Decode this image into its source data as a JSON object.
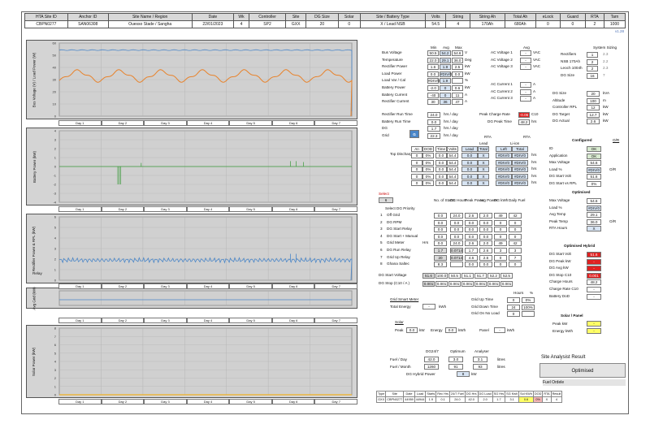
{
  "header": {
    "labels": [
      "HTA Site ID",
      "Anchor ID",
      "Site Name / Region",
      "Date",
      "Wk",
      "Controller",
      "Site",
      "DG Size",
      "Solar",
      "Site / Battery Type",
      "Volts",
      "String",
      "String Ah",
      "Total Ah",
      "eLock",
      "Guard",
      "RTA",
      "Tarn"
    ],
    "values": [
      "CBPN0277",
      "SAN06308",
      "Ouesso Stade / Sangha",
      "22/01/2023",
      "4",
      "SP2",
      "GXX",
      "20",
      "0",
      "X / Lead NSB",
      "54.5",
      "4",
      "170Ah",
      "680Ah",
      "0",
      "0",
      "2",
      "1000"
    ]
  },
  "version": "v1.28",
  "days": [
    "Day 1",
    "Day 2",
    "Day 3",
    "Day 4",
    "Day 5",
    "Day 6",
    "Day 7"
  ],
  "charts": {
    "bus_voltage": {
      "ylabel": "Bus Voltage (V) / Load Power (W)",
      "yticks": [
        "60",
        "50",
        "40",
        "30",
        "20",
        "10",
        "0"
      ],
      "colors": {
        "voltage": "#4a86c8",
        "load": "#e8822a"
      }
    },
    "battery_power": {
      "ylabel": "Battery Power (kW)",
      "yticks": [
        "4",
        "3",
        "2",
        "1",
        "0",
        "-1",
        "-2",
        "-3",
        "-4"
      ],
      "color": "#3a9a3a"
    },
    "rectifier_power": {
      "ylabel": "Rectifier Power & RPL (kW)",
      "yticks": [
        "6",
        "5",
        "4",
        "3",
        "2",
        "1",
        "0"
      ],
      "color": "#4a86c8",
      "side_label": "Relay"
    },
    "relay": {
      "ylabel": "Avg Grid (kW)"
    },
    "solar_power": {
      "ylabel": "Solar Power (kW)",
      "yticks": [
        "8",
        "7",
        "6",
        "5",
        "4",
        "3",
        "2",
        "1",
        "0"
      ],
      "color": "#f0b020"
    }
  },
  "stats": {
    "cols": [
      "Min",
      "Avg",
      "Max"
    ],
    "rows": [
      {
        "label": "Bus Voltage",
        "vals": [
          "50.5",
          "54.2",
          "54.6"
        ],
        "unit": "V"
      },
      {
        "label": "Temperature",
        "vals": [
          "22.0",
          "29.1",
          "36.0"
        ],
        "unit": "Deg"
      },
      {
        "label": "Rectifier Power",
        "vals": [
          "1.6",
          "1.9",
          "2.5"
        ],
        "unit": "kW"
      },
      {
        "label": "Load Power",
        "vals": [
          "0.0",
          "#DIV/0",
          "0.0"
        ],
        "unit": "kW"
      },
      {
        "label": "Load Var / Cal",
        "vals": [
          "#DIV/0",
          "1.9",
          ""
        ],
        "unit": "%"
      },
      {
        "label": "Battery Power",
        "vals": [
          "-2.0",
          "0",
          "0.6"
        ],
        "unit": "kW"
      },
      {
        "label": "Battery Current",
        "vals": [
          "-40",
          "0",
          "11"
        ],
        "unit": "A"
      },
      {
        "label": "Rectifier Current",
        "vals": [
          "30",
          "36",
          "47"
        ],
        "unit": "A"
      }
    ],
    "ac_avg_label": "Avg",
    "ac": [
      {
        "label": "AC Voltage 1",
        "val": "-",
        "unit": "VAC"
      },
      {
        "label": "AC Voltage 2",
        "val": "-",
        "unit": "VAC"
      },
      {
        "label": "AC Voltage 3",
        "val": "-",
        "unit": "VAC"
      },
      {
        "label": "AC Current 1",
        "val": "-",
        "unit": "A"
      },
      {
        "label": "AC Current 2",
        "val": "-",
        "unit": "A"
      },
      {
        "label": "AC Current 3",
        "val": "-",
        "unit": "A"
      }
    ],
    "run": [
      {
        "label": "Rectifier Run Time",
        "val": "24.0",
        "unit": "hrs / day"
      },
      {
        "label": "Battery Run Time",
        "val": "0.0",
        "unit": "hrs / day"
      },
      {
        "label": "DG",
        "val": "1.7",
        "unit": "hrs / day"
      },
      {
        "label": "Grid",
        "val": "22.3",
        "unit": "hrs / day"
      }
    ],
    "peak_charge": {
      "label": "Peak Charge Rate",
      "val": "-0.06",
      "unit": "C10"
    },
    "dg_peak": {
      "label": "DG Peak Time",
      "val": "48.2",
      "unit": "hrs"
    }
  },
  "sizing": {
    "title": "System Sizing",
    "rows": [
      {
        "label": "Rectifiers",
        "val": "1",
        "extra": "2.3"
      },
      {
        "label": "NSB 170Ah",
        "val": "2",
        "extra": "2.2"
      },
      {
        "label": "Leoch 1004h",
        "val": "2",
        "extra": "2.3"
      },
      {
        "label": "DG Size",
        "val": "16",
        "extra": "7"
      }
    ],
    "dg": [
      {
        "label": "DG Size",
        "val": "20",
        "unit": "kVA"
      },
      {
        "label": "Altitude",
        "val": "100",
        "unit": "m"
      },
      {
        "label": "Controller RPL",
        "val": "12",
        "unit": "kW"
      },
      {
        "label": "DG Target",
        "val": "12.7",
        "unit": "kW"
      },
      {
        "label": "DG Actual",
        "val": "2.6",
        "unit": "kW"
      }
    ]
  },
  "discharges": {
    "title": "Top Discharges",
    "group_lead": "Lead",
    "group_liion": "Li-ion",
    "rta": "RTA",
    "cols": [
      "An",
      "DOD",
      "Time",
      "Volts",
      "Lead Left",
      "Total",
      "Left",
      "Total"
    ],
    "rows": [
      [
        "0",
        "0%",
        "0.0",
        "54.4",
        "0.0",
        "X",
        "#DIV/0",
        "#DIV/0"
      ],
      [
        "0",
        "0%",
        "0.0",
        "54.4",
        "0.0",
        "X",
        "#DIV/0",
        "#DIV/0"
      ],
      [
        "0",
        "0%",
        "0.0",
        "54.4",
        "0.0",
        "X",
        "#DIV/0",
        "#DIV/0"
      ],
      [
        "0",
        "0%",
        "0.0",
        "54.4",
        "0.0",
        "X",
        "#DIV/0",
        "#DIV/0"
      ],
      [
        "0",
        "0%",
        "0.0",
        "54.4",
        "0.0",
        "X",
        "#DIV/0",
        "#DIV/0"
      ]
    ],
    "unit": "hrs"
  },
  "configured": {
    "title": "Configured",
    "tag": "O/R",
    "rows": [
      {
        "label": "ID",
        "val": "OK"
      },
      {
        "label": "Application",
        "val": "OK"
      },
      {
        "label": "Max Voltage",
        "val": "54.6"
      },
      {
        "label": "Load %",
        "val": "#DIV/0"
      },
      {
        "label": "DG Start Volt",
        "val": "51.6"
      },
      {
        "label": "DG Start vs RPL",
        "val": "0%"
      }
    ]
  },
  "dg_priority": {
    "select_label": "Select",
    "select_val": "6",
    "title": "Select DG Priority",
    "cols": [
      "No. of Starts",
      "DG Hours",
      "Peak Power",
      "Avg Power",
      "DG kWh",
      "Daily Fuel"
    ],
    "rows": [
      {
        "n": "1",
        "label": "Off Grid",
        "vals": [
          "0.0",
          "24.0",
          "2.6",
          "2.0",
          "49",
          "42"
        ]
      },
      {
        "n": "2",
        "label": "DG RPM",
        "vals": [
          "0.0",
          "0.0",
          "0.0",
          "0.0",
          "0",
          "0"
        ]
      },
      {
        "n": "3",
        "label": "DG Start Relay",
        "vals": [
          "0.0",
          "0.0",
          "0.0",
          "0.0",
          "0",
          "0"
        ]
      },
      {
        "n": "4",
        "label": "DG Start + Manual",
        "vals": [
          "0.0",
          "0.0",
          "0.0",
          "0.0",
          "0",
          "0"
        ]
      },
      {
        "n": "5",
        "label": "Grid Meter",
        "vals": [
          "0.0",
          "24.0",
          "2.6",
          "2.0",
          "49",
          "42"
        ],
        "hrs": "Hrs"
      },
      {
        "n": "6",
        "label": "DG Run Relay",
        "vals": [
          "1.7",
          "0.0714",
          "1.7",
          "2.6",
          "3",
          "3"
        ]
      },
      {
        "n": "7",
        "label": "Grid Up Relay",
        "vals": [
          "20",
          "0.0714",
          "4.6",
          "2.6",
          "0",
          "7"
        ]
      },
      {
        "n": "8",
        "label": "Ghana Saltec",
        "vals": [
          "8.3",
          "",
          "0.0",
          "0.0",
          "0",
          "0"
        ]
      }
    ],
    "start_voltage": {
      "label": "DG Start Voltage",
      "vals": [
        "51.6",
        "100.0",
        "50.5",
        "51.1",
        "51.7",
        "52.2",
        "52.5"
      ]
    },
    "stop": {
      "label": "DG Stop (C10 / A )",
      "vals": [
        "0.001",
        "0.001",
        "0.001",
        "0.001",
        "0.001",
        "0.001",
        "0.001"
      ]
    }
  },
  "optimised": {
    "title": "Optimised",
    "rows": [
      {
        "label": "Max Voltage",
        "val": "54.6"
      },
      {
        "label": "Load %",
        "val": "#DIV/0"
      },
      {
        "label": "Avg Temp",
        "val": "29.1"
      },
      {
        "label": "Peak Temp",
        "val": "36.0"
      },
      {
        "label": "RTA Hours",
        "val": "X"
      }
    ],
    "tag": "O/R"
  },
  "hybrid": {
    "title": "Optimised Hybrid",
    "rows": [
      {
        "label": "DG Start Volt",
        "val": "51.6"
      },
      {
        "label": "DG Peak kW",
        "val": "-"
      },
      {
        "label": "DG Avg kW",
        "val": "-"
      },
      {
        "label": "DG Stop C10",
        "val": "0.001"
      },
      {
        "label": "Charge Hours",
        "val": "48.2"
      },
      {
        "label": "Charge Rate C10",
        "val": "-"
      },
      {
        "label": "Battery DoD",
        "val": "-"
      }
    ],
    "hours_label": "Hours",
    "pct_label": "%"
  },
  "grid_meter": {
    "title": "Grid Smart Meter",
    "total_energy": {
      "label": "Total Energy",
      "val": "-",
      "unit": "kWh"
    },
    "rows": [
      {
        "label": "Grid Up Time",
        "hours": "0",
        "pct": "0%"
      },
      {
        "label": "Grid Down Time",
        "hours": "24",
        "pct": "100%"
      },
      {
        "label": "Grid On No Load",
        "hours": "0",
        "pct": ""
      }
    ]
  },
  "solar": {
    "title": "Solar",
    "peak": {
      "label": "Peak",
      "val": "0.0",
      "unit": "kW"
    },
    "energy": {
      "label": "Energy",
      "val": "0.0",
      "unit": "kWh"
    },
    "panel": {
      "label": "Panel",
      "val": "-",
      "unit": "kWh"
    },
    "panel_title": "Solar / Panel",
    "peak_kw": {
      "label": "Peak kW",
      "val": "-"
    },
    "energy_kwh": {
      "label": "Energy kWh",
      "val": "-"
    }
  },
  "fuel": {
    "cols": [
      "DG24/7",
      "Optimum",
      "Analyser"
    ],
    "day": {
      "label": "Fuel / Day",
      "vals": [
        "42.0",
        "3.0",
        "3.1"
      ],
      "unit": "litres"
    },
    "month": {
      "label": "Fuel / Month",
      "vals": [
        "1260",
        "91",
        "93"
      ],
      "unit": "litres"
    },
    "hybrid": {
      "label": "DG Hybrid Power",
      "val": "8",
      "unit": "kW"
    }
  },
  "result": {
    "title": "Site Analysist Result",
    "value": "Optimised",
    "note": "Fuel Ordele"
  },
  "footer": {
    "cols": [
      "Type",
      "Site",
      "Date",
      "Load",
      "Starts",
      "Rec Hrs",
      "24/7 Fuel",
      "DG Hrs",
      "DG Load",
      "SG Hrs",
      "SG Kwh",
      "Sol KWh",
      "DOD",
      "RTA",
      "Result"
    ],
    "vals": [
      "GXX",
      "CBPN0277",
      "44959",
      "44944",
      "1.9",
      "0.1",
      "24.0",
      "42.0",
      "2.0",
      "1.7",
      "3.1",
      "0.6",
      "0%",
      "X",
      "4"
    ]
  }
}
